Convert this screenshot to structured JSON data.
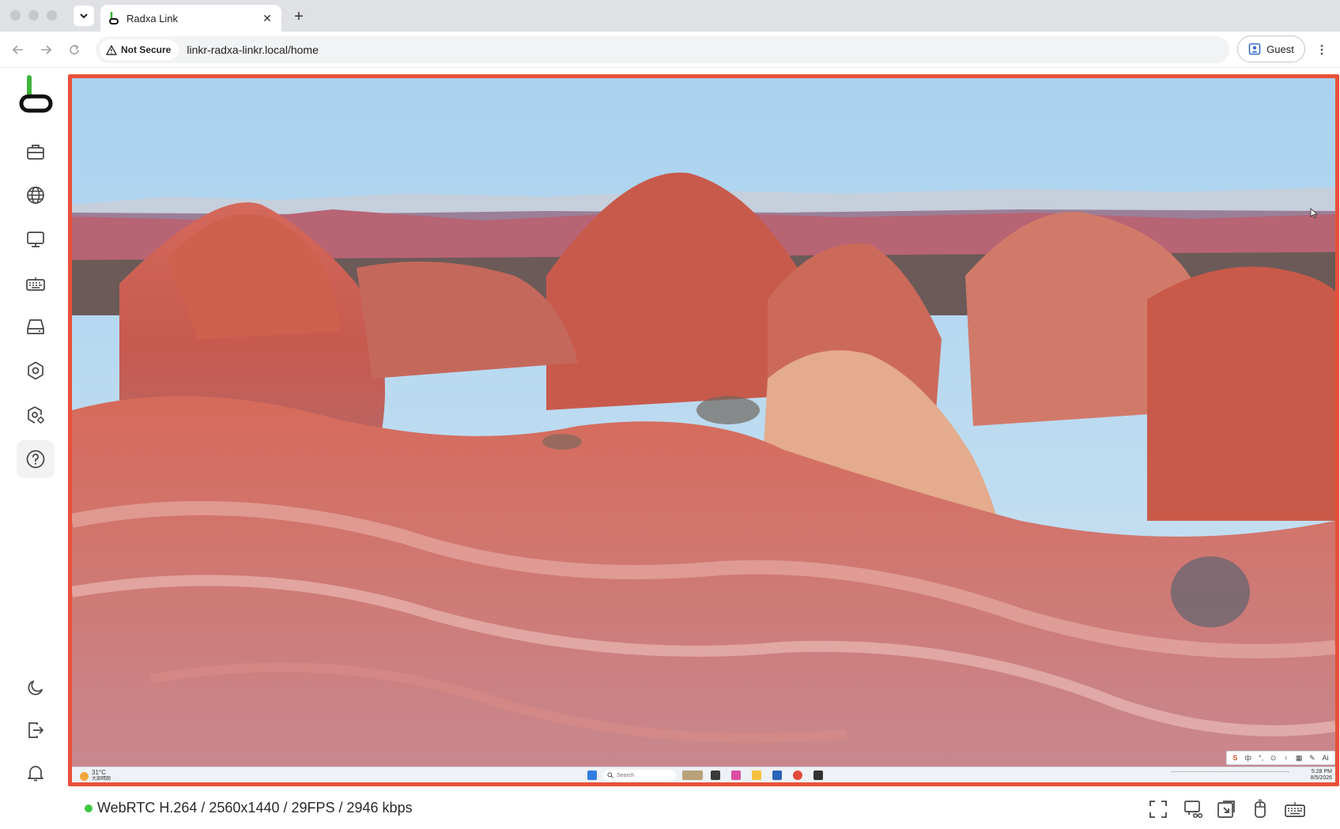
{
  "browser": {
    "tab_title": "Radxa Link",
    "security_label": "Not Secure",
    "url": "linkr-radxa-linkr.local/home",
    "profile_label": "Guest"
  },
  "sidebar": {
    "items": [
      {
        "name": "toolbox",
        "icon": "briefcase-icon"
      },
      {
        "name": "network",
        "icon": "globe-icon"
      },
      {
        "name": "display",
        "icon": "monitor-icon"
      },
      {
        "name": "keyboard",
        "icon": "keyboard-icon"
      },
      {
        "name": "storage",
        "icon": "drive-icon"
      },
      {
        "name": "settings",
        "icon": "settings-icon"
      },
      {
        "name": "advanced-settings",
        "icon": "gear-shield-icon"
      },
      {
        "name": "help",
        "icon": "help-icon",
        "active": true
      }
    ],
    "bottom_items": [
      {
        "name": "theme",
        "icon": "moon-icon"
      },
      {
        "name": "logout",
        "icon": "logout-icon"
      },
      {
        "name": "notifications",
        "icon": "bell-icon"
      }
    ]
  },
  "remote_desktop": {
    "taskbar": {
      "weather_temp": "31°C",
      "weather_desc": "大部晴朗",
      "search_placeholder": "Search",
      "time": "5:28 PM",
      "date": "8/5/2026"
    },
    "ime": [
      "S",
      "中",
      "°,",
      "⊙",
      "♀",
      "▦",
      "✎",
      "Ai"
    ]
  },
  "status": {
    "stream_info": "WebRTC H.264 / 2560x1440 / 29FPS / 2946 kbps",
    "indicator_color": "#3ec83e"
  },
  "colors": {
    "accent_border": "#e8503a",
    "brand_green": "#3fb43a"
  }
}
